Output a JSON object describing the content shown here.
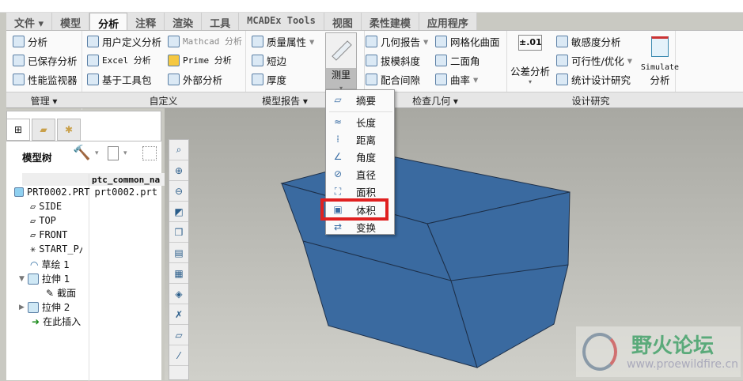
{
  "tabs": [
    {
      "label": "文件 ▾"
    },
    {
      "label": "模型"
    },
    {
      "label": "分析"
    },
    {
      "label": "注释"
    },
    {
      "label": "渲染"
    },
    {
      "label": "工具"
    },
    {
      "label": "MCADEx Tools"
    },
    {
      "label": "视图"
    },
    {
      "label": "柔性建模"
    },
    {
      "label": "应用程序"
    }
  ],
  "ribbon": {
    "manage": [
      "分析",
      "已保存分析",
      "性能监视器"
    ],
    "custom": [
      "用户定义分析",
      "Excel 分析",
      "基于工具包",
      "Mathcad 分析",
      "Prime 分析",
      "外部分析"
    ],
    "model_report": [
      "质量属性",
      "短边",
      "厚度"
    ],
    "measure": "测里",
    "inspect": [
      "几何报告",
      "拔模斜度",
      "配合间隙",
      "网格化曲面",
      "二面角",
      "曲率"
    ],
    "design": [
      "公差分析",
      "敏感度分析",
      "可行性/优化",
      "统计设计研究",
      "Simulate",
      "分析"
    ],
    "tol_icon": "±.01"
  },
  "groups": [
    "管理 ▾",
    "自定义",
    "模型报告 ▾",
    "检查几何 ▾",
    "设计研究"
  ],
  "measure_menu": [
    {
      "label": "摘要",
      "icon": "ruler-icon"
    },
    {
      "label": "长度",
      "icon": "length-icon"
    },
    {
      "label": "距离",
      "icon": "distance-icon"
    },
    {
      "label": "角度",
      "icon": "angle-icon"
    },
    {
      "label": "直径",
      "icon": "diameter-icon"
    },
    {
      "label": "面积",
      "icon": "area-icon"
    },
    {
      "label": "体积",
      "icon": "volume-icon"
    },
    {
      "label": "变换",
      "icon": "transform-icon"
    }
  ],
  "tree": {
    "title": "模型树",
    "column": "ptc_common_na",
    "items": [
      {
        "label": "PRT0002.PRT",
        "value": "prt0002.prt"
      },
      {
        "label": "SIDE"
      },
      {
        "label": "TOP"
      },
      {
        "label": "FRONT"
      },
      {
        "label": "START_P/"
      },
      {
        "label": "草绘 1"
      },
      {
        "label": "拉伸 1"
      },
      {
        "label": "截面"
      },
      {
        "label": "拉伸 2"
      },
      {
        "label": "在此插入"
      }
    ]
  },
  "watermark": {
    "title": "野火论坛",
    "url": "www.proewildfire.cn"
  },
  "colors": {
    "part": "#3a6aa0",
    "highlight": "#e02020"
  }
}
